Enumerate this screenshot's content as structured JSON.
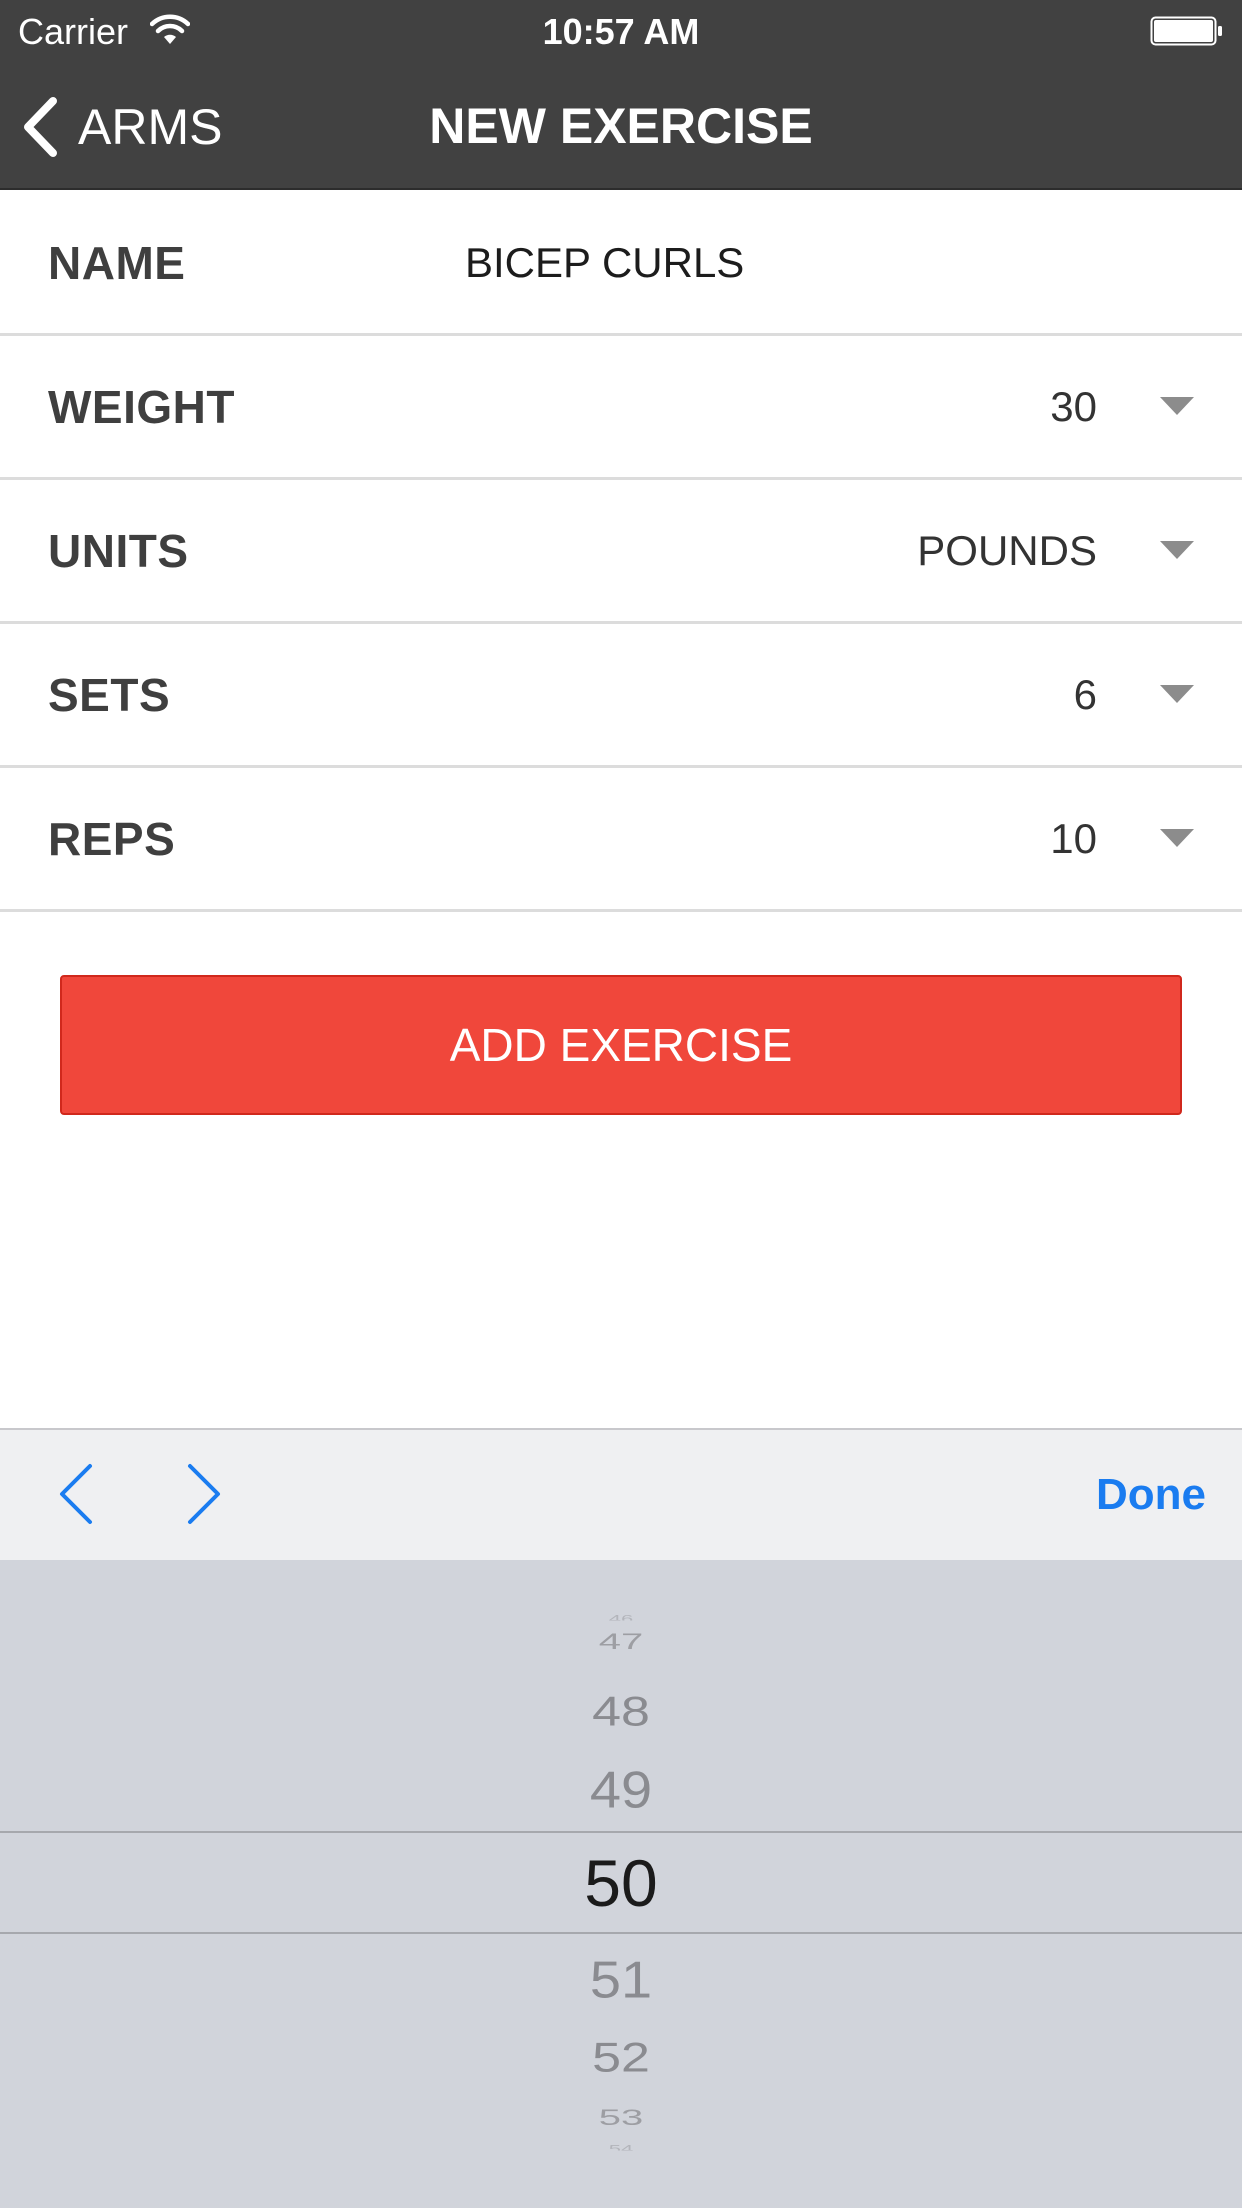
{
  "status_bar": {
    "carrier": "Carrier",
    "time": "10:57 AM",
    "wifi_icon": "wifi-icon",
    "battery_icon": "battery-icon"
  },
  "nav": {
    "back_label": "ARMS",
    "title": "NEW EXERCISE",
    "back_icon": "chevron-left-icon"
  },
  "form": {
    "name": {
      "label": "NAME",
      "value": "BICEP CURLS"
    },
    "weight": {
      "label": "WEIGHT",
      "value": "30"
    },
    "units": {
      "label": "UNITS",
      "value": "POUNDS"
    },
    "sets": {
      "label": "SETS",
      "value": "6"
    },
    "reps": {
      "label": "REPS",
      "value": "10"
    }
  },
  "add_button": {
    "label": "ADD EXERCISE"
  },
  "toolbar": {
    "prev_icon": "chevron-left-icon",
    "next_icon": "chevron-right-icon",
    "done_label": "Done"
  },
  "picker": {
    "items": [
      "46",
      "47",
      "48",
      "49",
      "50",
      "51",
      "52",
      "53",
      "54"
    ],
    "selected": "50"
  },
  "colors": {
    "nav_background": "#414141",
    "accent_button": "#f0473b",
    "toolbar_tint": "#1a7cf0",
    "picker_background": "#d1d4db"
  }
}
